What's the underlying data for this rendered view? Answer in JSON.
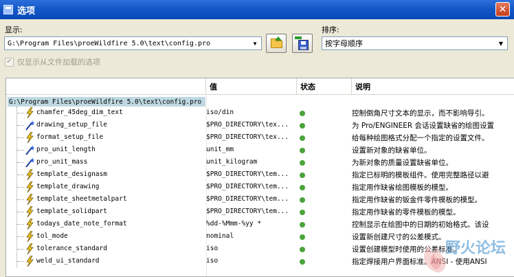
{
  "window": {
    "title": "选项"
  },
  "display": {
    "label": "显示:",
    "path": "G:\\Program Files\\proeWildfire 5.0\\text\\config.pro"
  },
  "sort": {
    "label": "排序:",
    "value": "按字母顺序"
  },
  "show_loaded": {
    "label": "仅显示从文件加载的选项",
    "checked": true
  },
  "columns": {
    "name": "",
    "value": "值",
    "status": "状态",
    "desc": "说明"
  },
  "root": {
    "label": "G:\\Program Files\\proeWildfire 5.0\\text\\config.pro"
  },
  "icons": {
    "bolt": "lightning-icon",
    "wand": "magic-wand-icon",
    "folder": "open-folder-icon",
    "save": "save-disk-icon"
  },
  "rows": [
    {
      "icon": "lightning-icon",
      "name": "chamfer_45deg_dim_text",
      "value": "iso/din",
      "desc": "控制倒角尺寸文本的显示，而不影响导引。"
    },
    {
      "icon": "magic-wand-icon",
      "name": "drawing_setup_file",
      "value": "$PRO_DIRECTORY\\tex...",
      "desc": "为 Pro/ENGINEER 会话设置缺省的绘图设置"
    },
    {
      "icon": "lightning-icon",
      "name": "format_setup_file",
      "value": "$PRO_DIRECTORY\\tex...",
      "desc": "给每种绘图格式分配一个指定的设置文件。"
    },
    {
      "icon": "magic-wand-icon",
      "name": "pro_unit_length",
      "value": "unit_mm",
      "desc": "设置新对象的缺省单位。"
    },
    {
      "icon": "magic-wand-icon",
      "name": "pro_unit_mass",
      "value": "unit_kilogram",
      "desc": "为新对象的质量设置缺省单位。"
    },
    {
      "icon": "lightning-icon",
      "name": "template_designasm",
      "value": "$PRO_DIRECTORY\\tem...",
      "desc": "指定已标明的模板组件。使用完整路径以避"
    },
    {
      "icon": "lightning-icon",
      "name": "template_drawing",
      "value": "$PRO_DIRECTORY\\tem...",
      "desc": "指定用作缺省绘图模板的模型。"
    },
    {
      "icon": "lightning-icon",
      "name": "template_sheetmetalpart",
      "value": "$PRO_DIRECTORY\\tem...",
      "desc": "指定用作缺省的钣金件零件模板的模型。"
    },
    {
      "icon": "lightning-icon",
      "name": "template_solidpart",
      "value": "$PRO_DIRECTORY\\tem...",
      "desc": "指定用作缺省的零件模板的模型。"
    },
    {
      "icon": "lightning-icon",
      "name": "todays_date_note_format",
      "value": "%dd-%Mmm-%yy *",
      "desc": "控制显示在绘图中的日期的初始格式。该设"
    },
    {
      "icon": "lightning-icon",
      "name": "tol_mode",
      "value": "nominal",
      "desc": "设置新创建尺寸的公差模式。"
    },
    {
      "icon": "lightning-icon",
      "name": "tolerance_standard",
      "value": "iso",
      "desc": "设置创建模型时使用的公差标准。"
    },
    {
      "icon": "lightning-icon",
      "name": "weld_ui_standard",
      "value": "iso",
      "desc": "指定焊接用户界面标准。ANSI - 使用ANSI"
    }
  ],
  "watermark": {
    "text": "野火论坛"
  },
  "colors": {
    "title_bar": "#0a48b8",
    "root_highlight": "#bfd9e2",
    "status_green": "#4aa33a"
  }
}
